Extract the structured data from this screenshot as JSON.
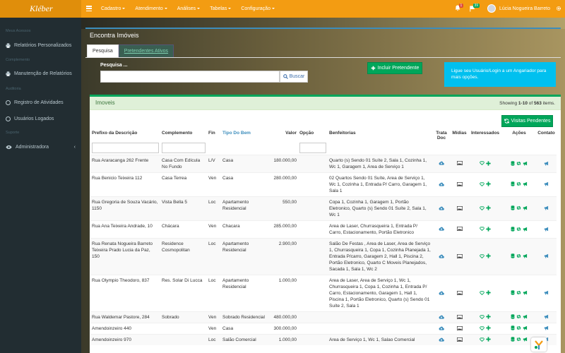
{
  "app": {
    "brand": "Kléber"
  },
  "topbar": {
    "menu": [
      "Cadastro",
      "Atendimento",
      "Análises",
      "Tabelas",
      "Configuração"
    ],
    "notifications_count": "1",
    "flags_count": "39",
    "user_name": "Lúcia Nogueira Barreto"
  },
  "sidebar": {
    "section1": "Meus Acessos",
    "item1": "Relatórios Personalizados",
    "section2": "Complemento",
    "item2": "Manutenção de Relatórios",
    "section3": "Auditoria",
    "item3": "Registro de Atividades",
    "item4": "Usuários Logados",
    "section4": "Suporte",
    "item5": "Administradora"
  },
  "page": {
    "title": "Encontra Imóveis",
    "tab_active": "Pesquisa",
    "tab_inactive": "Pretendentes Ativos",
    "search_label": "Pesquisa ...",
    "search_placeholder": "",
    "search_button": "Buscar",
    "incluir_button": "Incluir Pretendente",
    "info_text": "Ligue seu Usuário/Login a um Angariador para mais opções."
  },
  "panel": {
    "title": "Imoveis",
    "showing_prefix": "Showing ",
    "showing_range": "1-10",
    "showing_of": " of ",
    "showing_total": "563",
    "showing_suffix": " items.",
    "visitas_button": "Visitas Pendentes"
  },
  "table": {
    "headers": {
      "prefixo": "Prefixo da Descrição",
      "complemento": "Complemento",
      "fin": "Fin",
      "tipo": "Tipo Do Bem",
      "valor": "Valor",
      "opcao": "Opção",
      "benfeitorias": "Benfeitorias",
      "trata_doc": "Trata Doc",
      "midias": "Mídias",
      "interessados": "Interessados",
      "acoes": "Ações",
      "contato": "Contato"
    },
    "rows": [
      {
        "prefixo": "Rua Araracanga 262 Frente",
        "complemento": "Casa Com Edícula No Fundo",
        "fin": "L/V",
        "tipo": "Casa",
        "valor": "180.000,00",
        "benfeitorias": "Quarto (s) Sendo 01 Suíte 2, Sala 1, Cozinha 1, Wc 1, Garagem 1, Area de Serviço 1"
      },
      {
        "prefixo": "Rua Benicio Teixeira 112",
        "complemento": "Casa Terrea",
        "fin": "Ven",
        "tipo": "Casa",
        "valor": "280.000,00",
        "benfeitorias": "02 Quartos Sendo 01 Suíte, Area de Serviço 1, Wc 1, Cozinha 1, Entrada P/ Carro, Garagem 1, Sala 1"
      },
      {
        "prefixo": "Rua Gregoria de Souza Vacário, 1150",
        "complemento": "Vista Bella 5",
        "fin": "Loc",
        "tipo": "Apartamento Residencial",
        "valor": "550,00",
        "benfeitorias": "Copa 1, Cozinha 1, Garagem 1, Portão Eletronico, Quarto (s) Sendo 01 Suíte 2, Sala 1, Wc 1"
      },
      {
        "prefixo": "Rua Ana Teixeira Andrade, 10",
        "complemento": "Chácara",
        "fin": "Ven",
        "tipo": "Chacara",
        "valor": "285.000,00",
        "benfeitorias": "Area de Laser, Churrasqueira 1, Entrada P/ Carro, Estacionamento, Portão Eletronico"
      },
      {
        "prefixo": "Rua Renata Nogueira Barreto Teixeira Prado Lucia da Paz, 150",
        "complemento": "Residence Cosmopolitan",
        "fin": "Loc",
        "tipo": "Apartamento Residencial",
        "valor": "2.900,00",
        "benfeitorias": "Salão De Festas , Area de Laser, Area de Serviço 1, Churrasqueira 1, Copa 1, Cozinha Planejada 1, Entrada P/carro, Garagem 2, Hall 1, Piscina 2, Portão Eletronico, Quarto C Moveis Planejados, Sacada 1, Sala 1, Wc 2"
      },
      {
        "prefixo": "Rua Olympio Theodoro, 837",
        "complemento": "Res. Solar Di Lucca",
        "fin": "Loc",
        "tipo": "Apartamento Residencial",
        "valor": "1.000,00",
        "benfeitorias": "Area de Laser, Area de Serviço 1, Wc 1, Churrasqueira 1, Copa 1, Cozinha 1, Entrada P/ Carro, Estacionamento, Garagem 1, Hall 1, Piscina 1, Portão Eletronico, Quarto (s) Sendo 01 Suíte 2, Sala 1"
      },
      {
        "prefixo": "Rua Waldemar Pastore, 284",
        "complemento": "Sobrado",
        "fin": "Ven",
        "tipo": "Sobrado Residencial",
        "valor": "480.000,00",
        "benfeitorias": ""
      },
      {
        "prefixo": "Amendoinzeiro 440",
        "complemento": "",
        "fin": "Ven",
        "tipo": "Casa",
        "valor": "300.000,00",
        "benfeitorias": ""
      },
      {
        "prefixo": "Amendoinzeiro 970",
        "complemento": "",
        "fin": "Loc",
        "tipo": "Salão Comercial",
        "valor": "1.000,00",
        "benfeitorias": "Area de Serviço 1, Wc 1, Salao Comercial"
      }
    ]
  },
  "colors": {
    "topbar": "#f39c12",
    "sidebar": "#222d32",
    "green": "#00a65a",
    "info": "#00c0ef",
    "primary": "#3c8dbc"
  }
}
